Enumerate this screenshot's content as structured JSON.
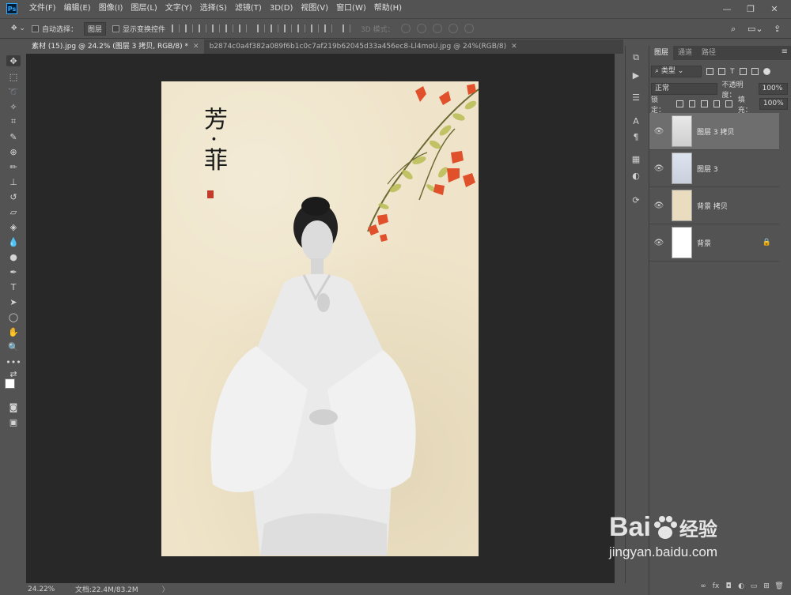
{
  "menubar": {
    "logo": "Ps",
    "items": [
      "文件(F)",
      "编辑(E)",
      "图像(I)",
      "图层(L)",
      "文字(Y)",
      "选择(S)",
      "滤镜(T)",
      "3D(D)",
      "视图(V)",
      "窗口(W)",
      "帮助(H)"
    ],
    "window_controls": [
      "—",
      "❐",
      "✕"
    ]
  },
  "options": {
    "auto_select_label": "自动选择：",
    "auto_select_target": "图层",
    "show_transform_label": "显示变换控件",
    "mode_3d_label": "3D 模式："
  },
  "tabs": [
    {
      "label": "素材 (15).jpg @ 24.2% (图层 3 拷贝, RGB/8) *",
      "close": "✕"
    },
    {
      "label": "b2874c0a4f382a089f6b1c0c7af219b62045d33a456ec8-Ll4moU.jpg @ 24%(RGB/8)",
      "close": "✕"
    }
  ],
  "document": {
    "calligraphy": "芳·菲"
  },
  "statusbar": {
    "zoom": "24.22%",
    "doc_info": "文档:22.4M/83.2M",
    "arrow": "〉"
  },
  "layers_panel": {
    "tabs": [
      "图层",
      "通道",
      "路径"
    ],
    "filter_kind": "类型",
    "blend_mode": "正常",
    "opacity_label": "不透明度：",
    "opacity_value": "100%",
    "lock_label": "锁定：",
    "fill_label": "填充：",
    "fill_value": "100%",
    "layers": [
      {
        "name": "图层 3 拷贝",
        "active": true
      },
      {
        "name": "图层 3",
        "active": false
      },
      {
        "name": "背景 拷贝",
        "active": false
      },
      {
        "name": "背景",
        "active": false,
        "locked": true
      }
    ],
    "bottom_buttons": [
      "∞",
      "fx",
      "◘",
      "◐",
      "▭",
      "⊞",
      "🗑"
    ]
  },
  "watermark": {
    "brand_a": "Bai",
    "brand_b": "经验",
    "url": "jingyan.baidu.com"
  }
}
